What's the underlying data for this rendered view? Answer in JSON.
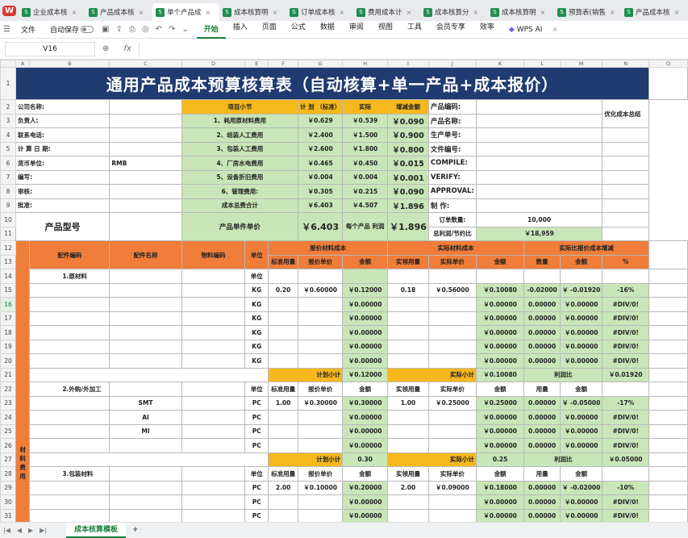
{
  "tabs": [
    {
      "label": "企业成本核",
      "active": false
    },
    {
      "label": "产品成本核",
      "active": false
    },
    {
      "label": "单个产品成",
      "active": true
    },
    {
      "label": "成本核算明",
      "active": false
    },
    {
      "label": "订单成本核",
      "active": false
    },
    {
      "label": "费用成本计",
      "active": false
    },
    {
      "label": "成本核算分",
      "active": false
    },
    {
      "label": "成本核算明",
      "active": false
    },
    {
      "label": "预算表(销售",
      "active": false
    },
    {
      "label": "产品成本核",
      "active": false
    }
  ],
  "logo": "W",
  "menu": {
    "file": "文件",
    "autosave": "自动保存",
    "items": [
      "开始",
      "插入",
      "页面",
      "公式",
      "数据",
      "审阅",
      "视图",
      "工具",
      "会员专享",
      "效率"
    ],
    "active": "开始",
    "ai": "WPS AI"
  },
  "formula": {
    "cell": "V16",
    "fx": "fx"
  },
  "columns": [
    "A",
    "B",
    "C",
    "D",
    "E",
    "F",
    "G",
    "H",
    "I",
    "J",
    "K",
    "L",
    "M",
    "N",
    "O"
  ],
  "title": "通用产品成本预算核算表（自动核算+单一产品+成本报价）",
  "info_left": [
    {
      "row": "2",
      "label": "公司名称:",
      "value": ""
    },
    {
      "row": "3",
      "label": "负责人:",
      "value": ""
    },
    {
      "row": "4",
      "label": "联系电话:",
      "value": ""
    },
    {
      "row": "5",
      "label": "计 算 日 期:",
      "value": ""
    },
    {
      "row": "6",
      "label": "货币单位:",
      "value": "RMB"
    },
    {
      "row": "7",
      "label": "编写:",
      "value": ""
    },
    {
      "row": "8",
      "label": "审核:",
      "value": ""
    },
    {
      "row": "9",
      "label": "批准:",
      "value": ""
    }
  ],
  "summary_header": {
    "item": "项目小节",
    "plan": "计 划 （标准）",
    "actual": "实际",
    "diff": "增减金额"
  },
  "summary": [
    {
      "name": "1、耗用原材料费用",
      "plan": "￥0.629",
      "actual": "￥0.539",
      "diff": "￥0.090"
    },
    {
      "name": "2、组装人工费用",
      "plan": "￥2.400",
      "actual": "￥1.500",
      "diff": "￥0.900"
    },
    {
      "name": "3、包装人工费用",
      "plan": "￥2.600",
      "actual": "￥1.800",
      "diff": "￥0.800"
    },
    {
      "name": "4、厂房水电费用",
      "plan": "￥0.465",
      "actual": "￥0.450",
      "diff": "￥0.015"
    },
    {
      "name": "5、设备折旧费用",
      "plan": "￥0.004",
      "actual": "￥0.004",
      "diff": "￥0.001"
    },
    {
      "name": "6、管理费用:",
      "plan": "￥0.305",
      "actual": "￥0.215",
      "diff": "￥0.090"
    },
    {
      "name": "成本总费合计",
      "plan": "￥6.403",
      "actual": "￥4.507",
      "diff": "￥1.896"
    }
  ],
  "info_right": [
    {
      "label": "产品编码:",
      "value": ""
    },
    {
      "label": "产品名称:",
      "value": ""
    },
    {
      "label": "生产单号:",
      "value": ""
    },
    {
      "label": "文件编号:",
      "value": ""
    },
    {
      "label": "COMPILE:",
      "value": ""
    },
    {
      "label": "VERIFY:",
      "value": ""
    },
    {
      "label": "APPROVAL:",
      "value": ""
    },
    {
      "label": "制 作:",
      "value": ""
    }
  ],
  "optimize_label": "优化成本总结",
  "row10": {
    "order_label": "订单数量:",
    "order_value": "10,000"
  },
  "row11": {
    "model_label": "产品型号",
    "unit_price_label": "产品单件单价",
    "unit_price": "￥6.403",
    "profit_label": "每个产品 利润",
    "profit": "￥1.896",
    "total_label": "总利润/节约比",
    "total": "￥18,959"
  },
  "detail_header": {
    "code": "配件编码",
    "name": "配件名称",
    "material": "物料编码",
    "unit": "单位",
    "quote_group": "报价材料成本",
    "actual_group": "实际材料成本",
    "ratio_group": "实际比报价成本增减",
    "std_qty": "标准用量",
    "quote_price": "报价单价",
    "amount": "金额",
    "act_qty": "实领用量",
    "act_price": "实际单价",
    "qty": "数量",
    "pct": "%"
  },
  "side_label": "材料费用",
  "detail_rows": [
    {
      "num": "14",
      "b": "1.原材料",
      "c": "",
      "e": "单位",
      "f": "",
      "g": "",
      "h": "",
      "i": "",
      "j": "",
      "k": "",
      "l": "",
      "m": "",
      "n": ""
    },
    {
      "num": "15",
      "b": "",
      "c": "",
      "e": "KG",
      "f": "0.20",
      "g": "￥0.60000",
      "h": "￥0.12000",
      "i": "0.18",
      "j": "￥0.56000",
      "k": "￥0.10080",
      "l": "-0.02000",
      "m": "￥ -0.01920",
      "n": "-16%"
    },
    {
      "num": "16",
      "b": "",
      "c": "",
      "e": "KG",
      "f": "",
      "g": "",
      "h": "￥0.00000",
      "i": "",
      "j": "",
      "k": "￥0.00000",
      "l": "0.00000",
      "m": "￥0.00000",
      "n": "#DIV/0!"
    },
    {
      "num": "17",
      "b": "",
      "c": "",
      "e": "KG",
      "f": "",
      "g": "",
      "h": "￥0.00000",
      "i": "",
      "j": "",
      "k": "￥0.00000",
      "l": "0.00000",
      "m": "￥0.00000",
      "n": "#DIV/0!"
    },
    {
      "num": "18",
      "b": "",
      "c": "",
      "e": "KG",
      "f": "",
      "g": "",
      "h": "￥0.00000",
      "i": "",
      "j": "",
      "k": "￥0.00000",
      "l": "0.00000",
      "m": "￥0.00000",
      "n": "#DIV/0!"
    },
    {
      "num": "19",
      "b": "",
      "c": "",
      "e": "KG",
      "f": "",
      "g": "",
      "h": "￥0.00000",
      "i": "",
      "j": "",
      "k": "￥0.00000",
      "l": "0.00000",
      "m": "￥0.00000",
      "n": "#DIV/0!"
    },
    {
      "num": "20",
      "b": "",
      "c": "",
      "e": "KG",
      "f": "",
      "g": "",
      "h": "￥0.00000",
      "i": "",
      "j": "",
      "k": "￥0.00000",
      "l": "0.00000",
      "m": "￥0.00000",
      "n": "#DIV/0!"
    },
    {
      "num": "21",
      "subtotal": true,
      "plan_label": "计划小计",
      "plan": "￥0.12000",
      "act_label": "实际小计",
      "act": "￥0.10080",
      "ratio_label": "利润比",
      "ratio": "￥0.01920"
    },
    {
      "num": "22",
      "b": "2.外购/外加工",
      "c": "",
      "e": "单位",
      "f": "标准用量",
      "g": "报价单价",
      "h": "金额",
      "i": "实领用量",
      "j": "实际单价",
      "k": "金额",
      "l": "用量",
      "m": "金额",
      "n": "",
      "hdr": true
    },
    {
      "num": "23",
      "b": "",
      "c": "SMT",
      "e": "PC",
      "f": "1.00",
      "g": "￥0.30000",
      "h": "￥0.30000",
      "i": "1.00",
      "j": "￥0.25000",
      "k": "￥0.25000",
      "l": "0.00000",
      "m": "￥ -0.05000",
      "n": "-17%"
    },
    {
      "num": "24",
      "b": "",
      "c": "AI",
      "e": "PC",
      "f": "",
      "g": "",
      "h": "￥0.00000",
      "i": "",
      "j": "",
      "k": "￥0.00000",
      "l": "0.00000",
      "m": "￥0.00000",
      "n": "#DIV/0!"
    },
    {
      "num": "25",
      "b": "",
      "c": "MI",
      "e": "PC",
      "f": "",
      "g": "",
      "h": "￥0.00000",
      "i": "",
      "j": "",
      "k": "￥0.00000",
      "l": "0.00000",
      "m": "￥0.00000",
      "n": "#DIV/0!"
    },
    {
      "num": "26",
      "b": "",
      "c": "",
      "e": "PC",
      "f": "",
      "g": "",
      "h": "￥0.00000",
      "i": "",
      "j": "",
      "k": "￥0.00000",
      "l": "0.00000",
      "m": "￥0.00000",
      "n": "#DIV/0!"
    },
    {
      "num": "27",
      "subtotal": true,
      "plan_label": "计划小计",
      "plan": "0.30",
      "act_label": "实际小计",
      "act": "0.25",
      "ratio_label": "利润比",
      "ratio": "￥0.05000"
    },
    {
      "num": "28",
      "b": "3.包装材料",
      "c": "",
      "e": "单位",
      "f": "标准用量",
      "g": "报价单价",
      "h": "金额",
      "i": "实领用量",
      "j": "实际单价",
      "k": "金额",
      "l": "用量",
      "m": "金额",
      "n": "",
      "hdr": true
    },
    {
      "num": "29",
      "b": "",
      "c": "",
      "e": "PC",
      "f": "2.00",
      "g": "￥0.10000",
      "h": "￥0.20000",
      "i": "2.00",
      "j": "￥0.09000",
      "k": "￥0.18000",
      "l": "0.00000",
      "m": "￥ -0.02000",
      "n": "-10%"
    },
    {
      "num": "30",
      "b": "",
      "c": "",
      "e": "PC",
      "f": "",
      "g": "",
      "h": "￥0.00000",
      "i": "",
      "j": "",
      "k": "￥0.00000",
      "l": "0.00000",
      "m": "￥0.00000",
      "n": "#DIV/0!"
    },
    {
      "num": "31",
      "b": "",
      "c": "",
      "e": "PC",
      "f": "",
      "g": "",
      "h": "￥0.00000",
      "i": "",
      "j": "",
      "k": "￥0.00000",
      "l": "0.00000",
      "m": "￥0.00000",
      "n": "#DIV/0!"
    }
  ],
  "sheet_tab": "成本核算模板",
  "colors": {
    "title_bg": "#1f3b70",
    "yellow": "#f7b81e",
    "green": "#c8e6b8",
    "orange": "#f07d3a",
    "accent": "#1a7f3c"
  }
}
